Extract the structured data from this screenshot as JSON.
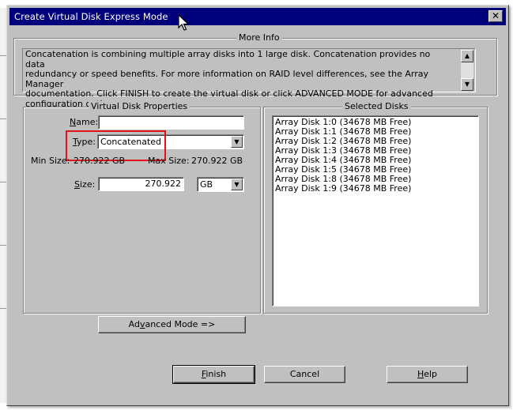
{
  "window": {
    "title": "Create Virtual Disk Express Mode"
  },
  "more_info": {
    "label": "More Info",
    "lines": [
      "Concatenation is combining multiple array disks into 1 large disk.  Concatenation provides no data",
      "redundancy or speed benefits.  For more information on RAID level differences, see the Array Manager",
      "documentation.  Click FINISH to create the virtual disk or click ADVANCED MODE for advanced",
      "configuration options."
    ]
  },
  "properties": {
    "label": "Virtual Disk Properties",
    "name_label_prefix": "N",
    "name_label_rest": "ame:",
    "name_value": "",
    "type_label_prefix": "T",
    "type_label_rest": "ype:",
    "type_value": "Concatenated",
    "min_size_label": "Min Size:",
    "min_size_value": "270.922 GB",
    "max_size_label": "Max Size:",
    "max_size_value": "270.922 GB",
    "size_label_prefix": "S",
    "size_label_rest": "ize:",
    "size_value": "270.922",
    "unit_value": "GB"
  },
  "selected_disks": {
    "label": "Selected Disks",
    "items": [
      "Array Disk 1:0 (34678 MB Free)",
      "Array Disk 1:1 (34678 MB Free)",
      "Array Disk 1:2 (34678 MB Free)",
      "Array Disk 1:3 (34678 MB Free)",
      "Array Disk 1:4 (34678 MB Free)",
      "Array Disk 1:5 (34678 MB Free)",
      "Array Disk 1:8 (34678 MB Free)",
      "Array Disk 1:9 (34678 MB Free)"
    ]
  },
  "buttons": {
    "advanced_prefix": "Ad",
    "advanced_mnemonic": "v",
    "advanced_rest": "anced Mode =>",
    "finish_mnemonic": "F",
    "finish_rest": "inish",
    "cancel": "Cancel",
    "help_mnemonic": "H",
    "help_rest": "elp"
  },
  "icons": {
    "close": "close-icon",
    "scroll_up": "scroll-up-icon",
    "scroll_down": "scroll-down-icon",
    "dropdown": "chevron-down-icon",
    "cursor": "mouse-pointer-icon"
  },
  "colors": {
    "titlebar": "#00007b",
    "face": "#c0c0c0",
    "highlight_box": "#e4101c"
  }
}
